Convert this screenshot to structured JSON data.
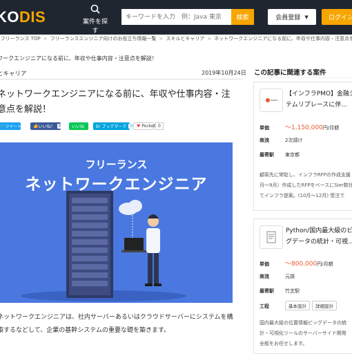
{
  "header": {
    "logo_prefix": "KO",
    "logo_text": "DIS",
    "find_label": "案件を探す",
    "search_placeholder": "キーワードを入力　例：Java 東京",
    "search_button": "検索",
    "register_label": "会員登録",
    "login_label": "ログイン"
  },
  "breadcrumb": [
    "S フリーランス TOP",
    "フリーランスエンジニア向けのお役立ち情報一覧",
    "スキルとキャリア",
    "ネットワークエンジニアになる前に、年収や仕事内容・注意点を解説！"
  ],
  "article": {
    "small_title": "ワークエンジニアになる前に、年収や仕事内容・注意点を解説！",
    "category": "とキャリア",
    "date": "2019年10月24日",
    "title": "ネットワークエンジニアになる前に、年収や仕事内容・注意点を解説！",
    "share": {
      "tweet": "ツイート",
      "fb_like": "いいね！",
      "fb_count": "0",
      "line": "いいね",
      "hatena": "B! ブックマーク",
      "hatena_count": "0",
      "pocket": "Pocket",
      "pocket_count": "0"
    },
    "hero": {
      "line1": "フリーランス",
      "line2": "ネットワークエンジニア"
    },
    "body": "ネットワークエンジニアは、社内サーバーあるいはクラウドサーバーにシステムを構築するなどして、企業の基幹システムの重要な礎を築きます。"
  },
  "sidebar": {
    "title": "この記事に関連する案件",
    "cards": [
      {
        "title": "【インフラPMO】金融システムリプレースに伴…",
        "price_label": "単価",
        "price": "～1,150,000",
        "price_unit": "円/月額",
        "commerce_label": "商流",
        "commerce": "2次請け",
        "station_label": "最寄駅",
        "station": "東京都",
        "desc": [
          "顧客先に常駐し、インフラRFPの作成支援",
          "月〜9月）作成したRFPをベースにSier数社",
          "てインフラ提案。(10月〜12月) 受注で"
        ]
      },
      {
        "title": "Python/国内最大級のビッグデータの統計・可視…",
        "price_label": "単価",
        "price": "～800,000",
        "price_unit": "円/月額",
        "commerce_label": "商流",
        "commerce": "元請",
        "station_label": "最寄駅",
        "station": "竹芝駅",
        "process_label": "工程",
        "process_tags": [
          "基本設計",
          "詳細設計"
        ],
        "desc": [
          "国内最大級の位置情報ビッグデータの統",
          "計・可視化ツールのサーバーサイド開発",
          "全般をお任せします。"
        ]
      }
    ]
  },
  "colors": {
    "header_bg": "#1f2630",
    "accent": "#f7a600",
    "hero_bg": "#4a78e0",
    "price": "#e85a2e"
  }
}
